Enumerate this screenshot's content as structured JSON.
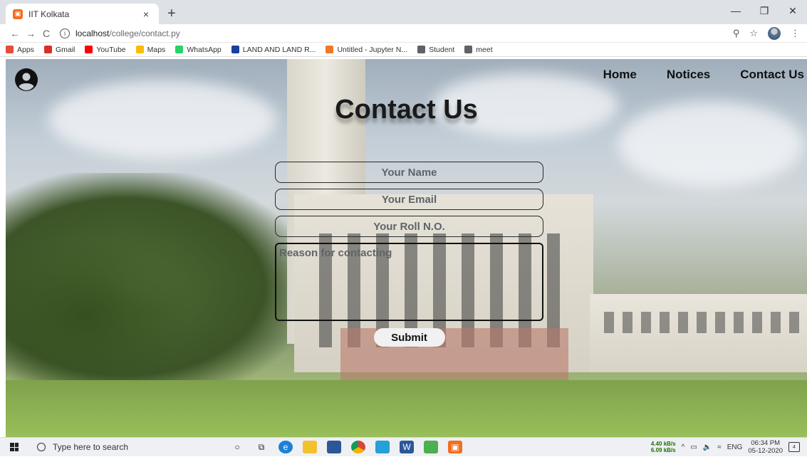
{
  "browser": {
    "tab": {
      "title": "IIT Kolkata",
      "close": "×"
    },
    "new_tab": "+",
    "window_controls": {
      "minimize": "—",
      "maximize": "❐",
      "close": "✕"
    },
    "nav": {
      "back": "←",
      "forward": "→",
      "reload": "C"
    },
    "address": {
      "host": "localhost",
      "path": "/college/contact.py"
    },
    "toolbar_icons": {
      "zoom": "⚲",
      "star": "☆",
      "menu": "⋮"
    },
    "bookmarks": [
      {
        "label": "Apps",
        "color": "#e54c3c"
      },
      {
        "label": "Gmail",
        "color": "#d93025"
      },
      {
        "label": "YouTube",
        "color": "#ff0000"
      },
      {
        "label": "Maps",
        "color": "#fbbc04"
      },
      {
        "label": "WhatsApp",
        "color": "#25d366"
      },
      {
        "label": "LAND AND LAND R...",
        "color": "#1a3f9c"
      },
      {
        "label": "Untitled - Jupyter N...",
        "color": "#f37626"
      },
      {
        "label": "Student",
        "color": "#5f6368"
      },
      {
        "label": "meet",
        "color": "#5f6368"
      }
    ]
  },
  "page": {
    "nav": {
      "home": "Home",
      "notices": "Notices",
      "contact": "Contact Us"
    },
    "heading": "Contact Us",
    "form": {
      "name_placeholder": "Your Name",
      "email_placeholder": "Your Email",
      "roll_placeholder": "Your Roll N.O.",
      "reason_placeholder": "Reason for contacting",
      "submit_label": "Submit"
    }
  },
  "taskbar": {
    "search_placeholder": "Type here to search",
    "net_up": "4.40 kB/s",
    "net_down": "6.09 kB/s",
    "language": "ENG",
    "time": "06:34 PM",
    "date": "05-12-2020",
    "notification_count": "4"
  }
}
